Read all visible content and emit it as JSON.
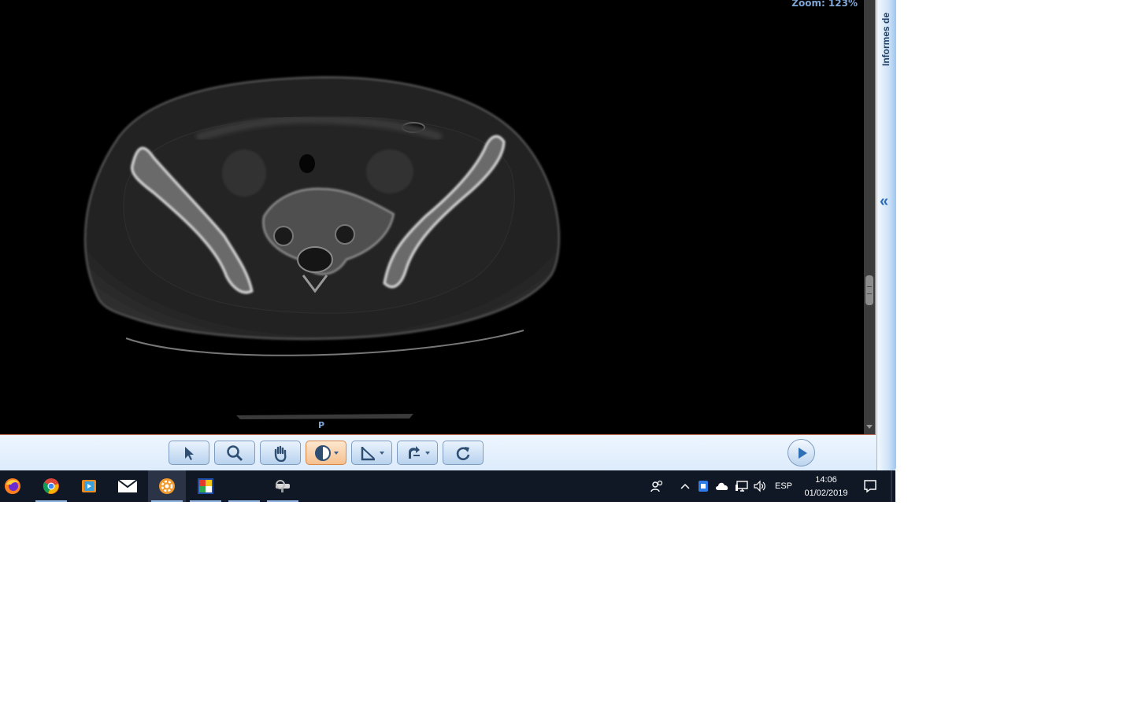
{
  "viewer": {
    "zoom_label": "Zoom: 123%",
    "orientation_bottom": "P"
  },
  "side_panel": {
    "title": "Informes de",
    "collapse_icon": "double-chevron-left-icon"
  },
  "toolbar": {
    "tools": [
      {
        "name": "pointer-tool",
        "icon": "cursor-arrow-icon",
        "active": false,
        "dropdown": false
      },
      {
        "name": "zoom-tool",
        "icon": "magnifier-icon",
        "active": false,
        "dropdown": false
      },
      {
        "name": "pan-tool",
        "icon": "hand-icon",
        "active": false,
        "dropdown": false
      },
      {
        "name": "window-level-tool",
        "icon": "contrast-icon",
        "active": true,
        "dropdown": true
      },
      {
        "name": "measure-tool",
        "icon": "ruler-angle-icon",
        "active": false,
        "dropdown": true
      },
      {
        "name": "rotate-flip-tool",
        "icon": "rotate-icon",
        "active": false,
        "dropdown": true
      },
      {
        "name": "reset-tool",
        "icon": "refresh-icon",
        "active": false,
        "dropdown": false
      }
    ],
    "play_icon": "play-icon"
  },
  "taskbar": {
    "apps": [
      {
        "name": "firefox",
        "icon": "firefox-icon",
        "running": false,
        "focused": false
      },
      {
        "name": "chrome",
        "icon": "chrome-icon",
        "running": true,
        "focused": false
      },
      {
        "name": "media-player",
        "icon": "media-player-icon",
        "running": false,
        "focused": false
      },
      {
        "name": "mail",
        "icon": "mail-icon",
        "running": false,
        "focused": false
      },
      {
        "name": "dicom-viewer",
        "icon": "orange-gear-icon",
        "running": true,
        "focused": true
      },
      {
        "name": "photo-app",
        "icon": "photo-app-icon",
        "running": true,
        "focused": false
      },
      {
        "name": "blank-app",
        "icon": "blank-icon",
        "running": true,
        "focused": false
      },
      {
        "name": "ct-scanner-app",
        "icon": "scanner-icon",
        "running": true,
        "focused": false
      }
    ],
    "tray": {
      "people_icon": "people-icon",
      "show_hidden_icon": "chevron-up-icon",
      "security_icon": "shield-icon",
      "cloud_icon": "cloud-icon",
      "network_icon": "network-icon",
      "volume_icon": "speaker-icon",
      "language": "ESP",
      "time": "14:06",
      "date": "01/02/2019",
      "notifications_icon": "notification-icon"
    }
  },
  "colors": {
    "viewer_background": "#000000",
    "overlay_text": "#7ea6d6",
    "active_tool": "#f6c08f",
    "taskbar": "#101826"
  }
}
